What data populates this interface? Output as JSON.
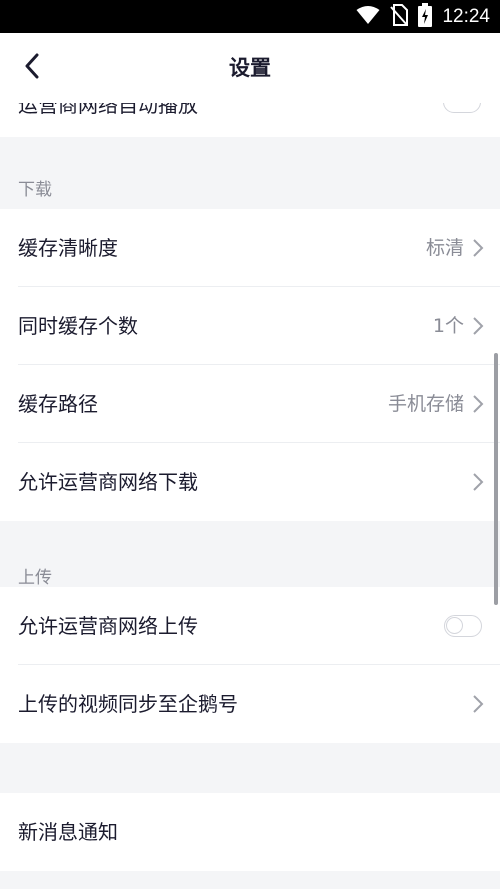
{
  "status_bar": {
    "time": "12:24"
  },
  "nav": {
    "title": "设置"
  },
  "top_partial": {
    "label": "运营商网络自动播放"
  },
  "download": {
    "header": "下载",
    "rows": [
      {
        "label": "缓存清晰度",
        "value": "标清"
      },
      {
        "label": "同时缓存个数",
        "value": "1个"
      },
      {
        "label": "缓存路径",
        "value": "手机存储"
      },
      {
        "label": "允许运营商网络下载",
        "value": ""
      }
    ]
  },
  "upload": {
    "header": "上传",
    "rows": [
      {
        "label": "允许运营商网络上传",
        "toggle": false
      },
      {
        "label": "上传的视频同步至企鹅号"
      }
    ]
  },
  "notifications": {
    "rows": [
      {
        "label": "新消息通知"
      }
    ]
  },
  "colors": {
    "text_primary": "#1b1b2e",
    "text_secondary": "#8a8c96",
    "background": "#f4f5f7",
    "toggle_border": "#d4d6dc"
  },
  "icons": [
    "wifi-icon",
    "no-sim-icon",
    "battery-charging-icon",
    "back-arrow-icon",
    "chevron-right-icon"
  ]
}
